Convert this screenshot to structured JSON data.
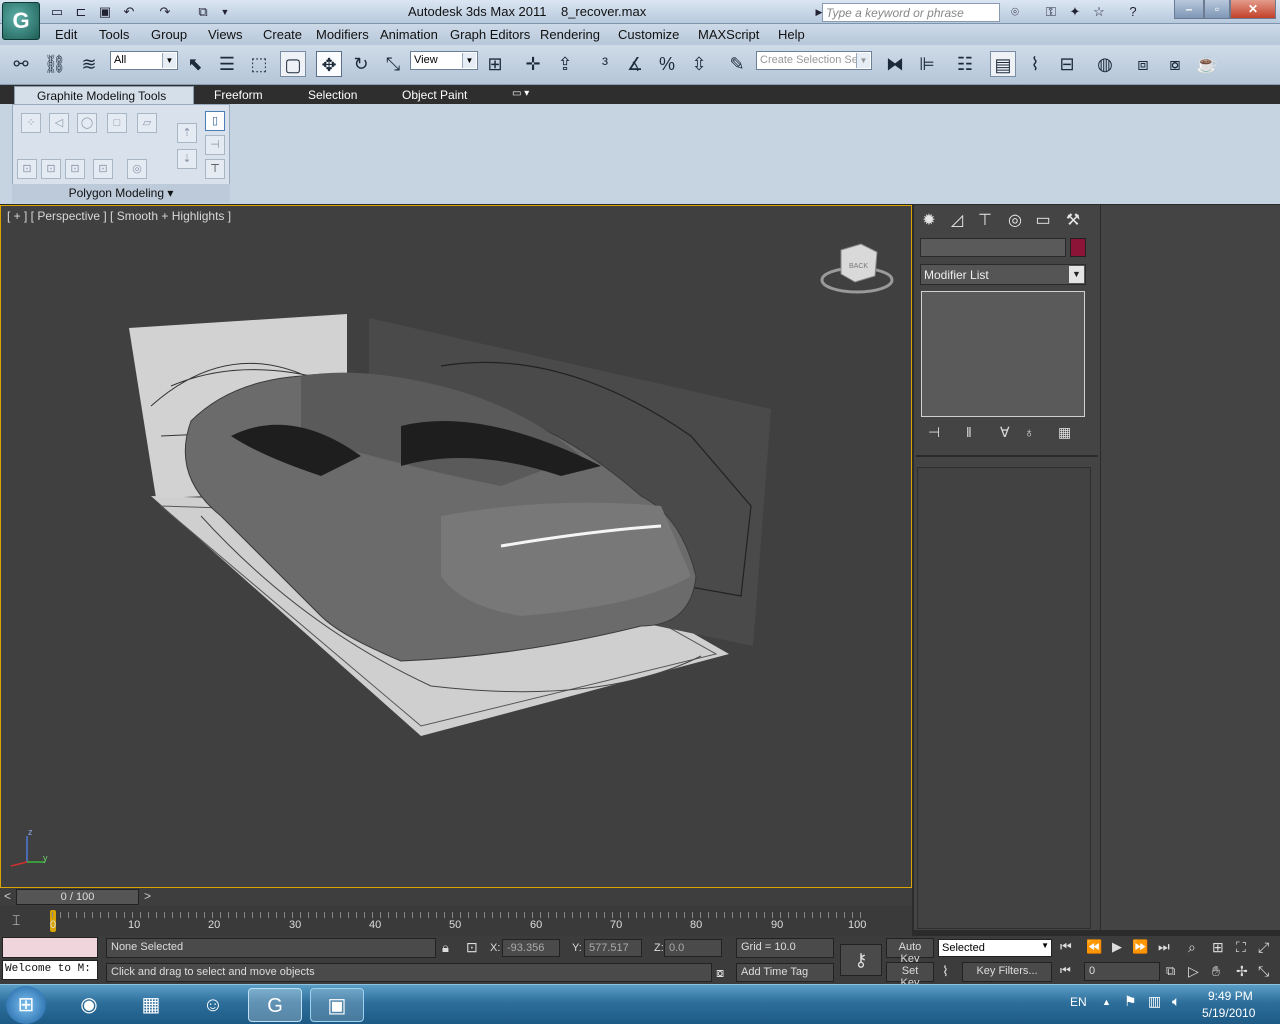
{
  "title": {
    "app_name": "Autodesk 3ds Max  2011",
    "file_name": "8_recover.max",
    "search_placeholder": "Type a keyword or phrase"
  },
  "menu": [
    "Edit",
    "Tools",
    "Group",
    "Views",
    "Create",
    "Modifiers",
    "Animation",
    "Graph Editors",
    "Rendering",
    "Customize",
    "MAXScript",
    "Help"
  ],
  "toolbar": {
    "selection_filter": "All",
    "ref_coord": "View",
    "named_selection_placeholder": "Create Selection Se"
  },
  "ribbon": {
    "tabs": [
      "Graphite Modeling Tools",
      "Freeform",
      "Selection",
      "Object Paint"
    ],
    "panel_label": "Polygon Modeling"
  },
  "viewport": {
    "label": "[ + ] [ Perspective ] [ Smooth + Highlights ]",
    "axis_z": "z",
    "axis_y": "y",
    "viewcube_text": "BACK"
  },
  "command_panel": {
    "modifier_list": "Modifier List",
    "accent_color": "#8b1437"
  },
  "timeline": {
    "frame_display": "0 / 100",
    "ticks": [
      "0",
      "10",
      "20",
      "30",
      "40",
      "50",
      "60",
      "70",
      "80",
      "90",
      "100"
    ]
  },
  "status": {
    "maxscript_text": "Welcome to M:",
    "selection": "None Selected",
    "prompt": "Click and drag to select and move objects",
    "x_label": "X:",
    "x_value": "-93.356",
    "y_label": "Y:",
    "y_value": "577.517",
    "z_label": "Z:",
    "z_value": "0.0",
    "grid": "Grid = 10.0",
    "add_time_tag": "Add Time Tag",
    "auto_key": "Auto Key",
    "set_key": "Set Key",
    "key_mode": "Selected",
    "key_filters": "Key Filters...",
    "current_frame": "0"
  },
  "taskbar": {
    "language": "EN",
    "time": "9:49 PM",
    "date": "5/19/2010"
  }
}
